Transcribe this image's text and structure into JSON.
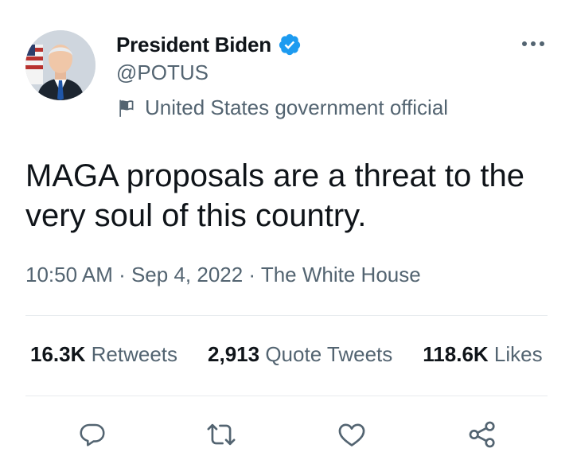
{
  "tweet": {
    "author": {
      "display_name": "President Biden",
      "handle": "@POTUS",
      "verified": true,
      "label": "United States government official"
    },
    "text": "MAGA proposals are a threat to the very soul of this country.",
    "meta": {
      "time": "10:50 AM",
      "separator": " · ",
      "date": "Sep 4, 2022",
      "source": "The White House"
    },
    "stats": {
      "retweets": {
        "count": "16.3K",
        "label": "Retweets"
      },
      "quote_tweets": {
        "count": "2,913",
        "label": "Quote Tweets"
      },
      "likes": {
        "count": "118.6K",
        "label": "Likes"
      }
    },
    "actions": [
      {
        "name": "reply",
        "icon": "reply-icon"
      },
      {
        "name": "retweet",
        "icon": "retweet-icon"
      },
      {
        "name": "like",
        "icon": "heart-icon"
      },
      {
        "name": "share",
        "icon": "share-icon"
      }
    ]
  },
  "colors": {
    "text_primary": "#0f1419",
    "text_secondary": "#536471",
    "verified_blue": "#1d9bf0",
    "divider": "#e7ebee"
  }
}
